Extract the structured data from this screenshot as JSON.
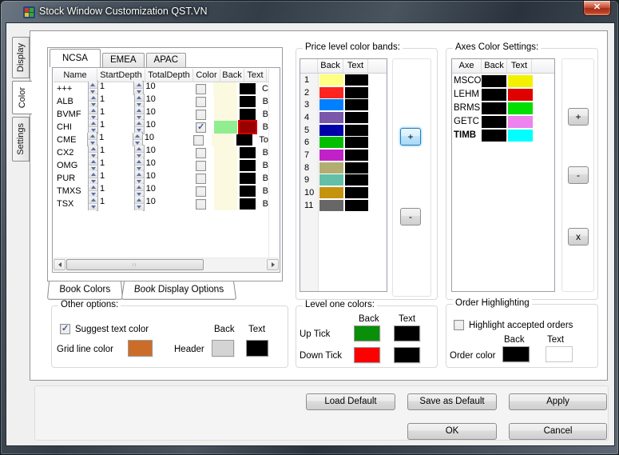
{
  "window": {
    "title": "Stock Window Customization QST.VN",
    "close_glyph": "✕",
    "icon_colors": [
      "#D8352A",
      "#35A82F",
      "#E8C21D",
      "#35A82F"
    ]
  },
  "side_tabs": [
    {
      "label": "Display",
      "active": false
    },
    {
      "label": "Color",
      "active": true
    },
    {
      "label": "Settings",
      "active": false
    }
  ],
  "region_tabs": [
    {
      "label": "NCSA",
      "active": true
    },
    {
      "label": "EMEA",
      "active": false
    },
    {
      "label": "APAC",
      "active": false
    }
  ],
  "book_tabs": [
    {
      "label": "Book Colors",
      "active": true
    },
    {
      "label": "Book Display Options",
      "active": false
    }
  ],
  "grid": {
    "columns": [
      "Name",
      "StartDepth",
      "TotalDepth",
      "Color",
      "Back",
      "Text"
    ],
    "rows": [
      {
        "name": "+++",
        "start": "1",
        "total": "10",
        "checked": false,
        "back": "#FBFAE0",
        "text": "#000000",
        "trail": "C",
        "selected": false
      },
      {
        "name": "ALB",
        "start": "1",
        "total": "10",
        "checked": false,
        "back": "#FBFAE0",
        "text": "#000000",
        "trail": "B",
        "selected": false
      },
      {
        "name": "BVMF",
        "start": "1",
        "total": "10",
        "checked": false,
        "back": "#FBFAE0",
        "text": "#000000",
        "trail": "B",
        "selected": false
      },
      {
        "name": "CHI",
        "start": "1",
        "total": "10",
        "checked": true,
        "back": "#90EE90",
        "text": "#990000",
        "trail": "B",
        "selected": true
      },
      {
        "name": "CME",
        "start": "1",
        "total": "10",
        "checked": false,
        "back": "#FBFAE0",
        "text": "#000000",
        "trail": "To",
        "selected": false
      },
      {
        "name": "CX2",
        "start": "1",
        "total": "10",
        "checked": false,
        "back": "#FBFAE0",
        "text": "#000000",
        "trail": "B",
        "selected": false
      },
      {
        "name": "OMG",
        "start": "1",
        "total": "10",
        "checked": false,
        "back": "#FBFAE0",
        "text": "#000000",
        "trail": "B",
        "selected": false
      },
      {
        "name": "PUR",
        "start": "1",
        "total": "10",
        "checked": false,
        "back": "#FBFAE0",
        "text": "#000000",
        "trail": "B",
        "selected": false
      },
      {
        "name": "TMXS",
        "start": "1",
        "total": "10",
        "checked": false,
        "back": "#FBFAE0",
        "text": "#000000",
        "trail": "B",
        "selected": false
      },
      {
        "name": "TSX",
        "start": "1",
        "total": "10",
        "checked": false,
        "back": "#FBFAE0",
        "text": "#000000",
        "trail": "B",
        "selected": false
      }
    ]
  },
  "price_bands": {
    "title": "Price level color bands:",
    "columns": [
      "Back",
      "Text"
    ],
    "add_label": "+",
    "remove_label": "-",
    "rows": [
      {
        "num": "1",
        "back": "#FFFF84",
        "text": "#000000"
      },
      {
        "num": "2",
        "back": "#FF2420",
        "text": "#000000"
      },
      {
        "num": "3",
        "back": "#0080FF",
        "text": "#000000"
      },
      {
        "num": "4",
        "back": "#7A57A9",
        "text": "#000000"
      },
      {
        "num": "5",
        "back": "#0000A8",
        "text": "#000000"
      },
      {
        "num": "6",
        "back": "#00BE00",
        "text": "#000000"
      },
      {
        "num": "7",
        "back": "#C122C7",
        "text": "#000000"
      },
      {
        "num": "8",
        "back": "#B2AE72",
        "text": "#000000"
      },
      {
        "num": "9",
        "back": "#63BFA8",
        "text": "#000000"
      },
      {
        "num": "10",
        "back": "#C4940E",
        "text": "#000000"
      },
      {
        "num": "11",
        "back": "#676767",
        "text": "#000000"
      }
    ]
  },
  "axes": {
    "title": "Axes Color Settings:",
    "columns": [
      "Axe",
      "Back",
      "Text"
    ],
    "add_label": "+",
    "remove_label": "-",
    "delete_label": "x",
    "rows": [
      {
        "axe": "MSCO",
        "back": "#000000",
        "text": "#F2F200",
        "bold": false
      },
      {
        "axe": "LEHM",
        "back": "#000000",
        "text": "#DF0000",
        "bold": false
      },
      {
        "axe": "BRMS",
        "back": "#000000",
        "text": "#00DF00",
        "bold": false
      },
      {
        "axe": "GETC",
        "back": "#000000",
        "text": "#EE82EE",
        "bold": false
      },
      {
        "axe": "TIMB",
        "back": "#000000",
        "text": "#00FFFF",
        "bold": true
      }
    ]
  },
  "other_options": {
    "title": "Other options:",
    "suggest_label": "Suggest  text color",
    "suggest_checked": true,
    "back_header": "Back",
    "text_header": "Text",
    "grid_line_label": "Grid line color",
    "grid_line_color": "#CB6D29",
    "header_label": "Header",
    "header_back": "#D4D4D4",
    "header_text": "#000000"
  },
  "level_one": {
    "title": "Level one colors:",
    "back_header": "Back",
    "text_header": "Text",
    "rows": [
      {
        "label": "Up Tick",
        "back": "#0A8F0A",
        "text": "#000000"
      },
      {
        "label": "Down Tick",
        "back": "#FF0000",
        "text": "#000000"
      }
    ]
  },
  "order_highlighting": {
    "title": "Order Highlighting",
    "checkbox_label": "Highlight accepted orders",
    "checked": false,
    "back_header": "Back",
    "text_header": "Text",
    "order_label": "Order color",
    "back": "#000000",
    "text": "#FFFFFF"
  },
  "buttons": {
    "load": "Load Default",
    "save": "Save as Default",
    "apply": "Apply",
    "ok": "OK",
    "cancel": "Cancel"
  }
}
